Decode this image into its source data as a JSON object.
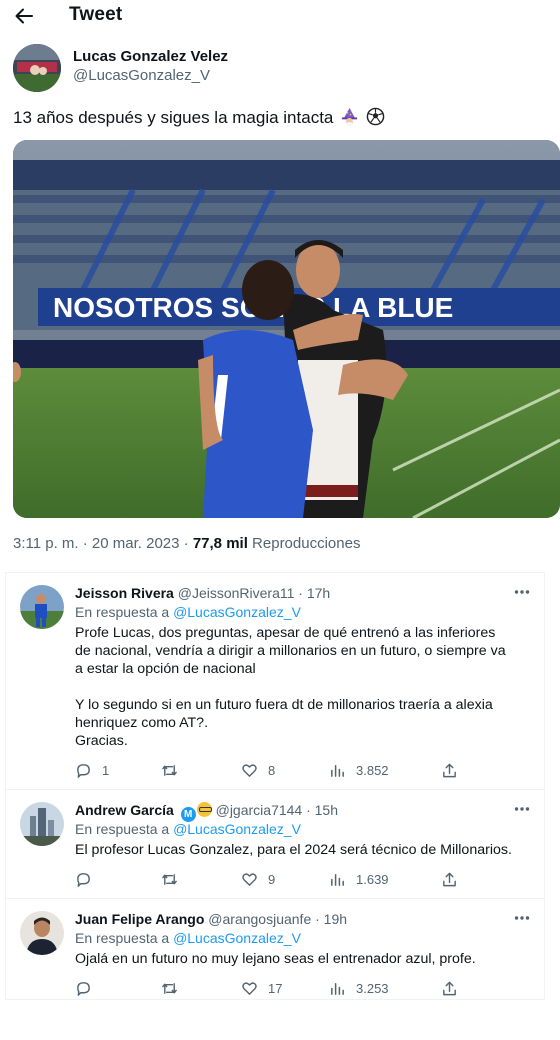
{
  "header": {
    "title": "Tweet"
  },
  "tweet": {
    "author_name": "Lucas Gonzalez Velez",
    "author_handle": "@LucasGonzalez_V",
    "text": "13 años después y sigues la magia intacta",
    "emojis": [
      "wizard-emoji",
      "soccer-ball-emoji"
    ],
    "media_banner_text": "NOSOTROS SOMOS LA BLUE",
    "time": "3:11 p. m. · 20 mar. 2023 ·",
    "views_count": "77,8 mil",
    "views_label": "Reproducciones"
  },
  "replies": [
    {
      "name": "Jeisson Rivera",
      "meta": "@JeissonRivera11 · 17h",
      "reply_prefix": "En respuesta a",
      "reply_handle": "@LucasGonzalez_V",
      "text_lines": [
        "Profe Lucas, dos preguntas, apesar de qué entrenó a las inferiores de nacional, vendría a dirigir a millonarios en un futuro, o siempre va a estar la opción de nacional",
        "",
        "Y lo segundo si en un futuro fuera dt de millonarios traería a alexia henriquez como AT?.",
        "Gracias."
      ],
      "replies": "1",
      "retweets": "",
      "likes": "8",
      "views": "3.852"
    },
    {
      "name": "Andrew García",
      "meta": "@jgarcia7144 · 15h",
      "reply_prefix": "En respuesta a",
      "reply_handle": "@LucasGonzalez_V",
      "text_lines": [
        "El profesor Lucas Gonzalez, para el 2024 será técnico de Millonarios."
      ],
      "replies": "",
      "retweets": "",
      "likes": "9",
      "views": "1.639"
    },
    {
      "name": "Juan Felipe Arango",
      "meta": "@arangosjuanfe · 19h",
      "reply_prefix": "En respuesta a",
      "reply_handle": "@LucasGonzalez_V",
      "text_lines": [
        "Ojalá en un futuro no muy lejano seas el entrenador azul, profe."
      ],
      "replies": "",
      "retweets": "",
      "likes": "17",
      "views": "3.253"
    }
  ],
  "colors": {
    "text": "#0f1419",
    "secondary": "#536471",
    "link": "#1d9bf0",
    "border": "#eff3f4"
  }
}
